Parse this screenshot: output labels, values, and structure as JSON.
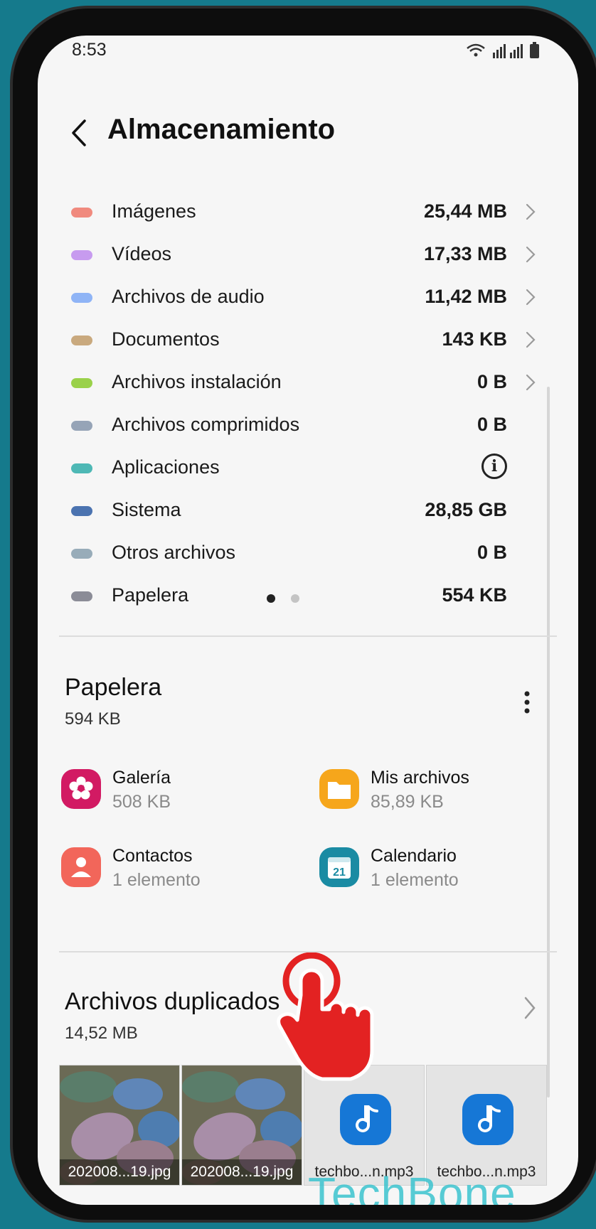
{
  "status": {
    "time": "8:53",
    "icons": "wifi-icon signal-icon signal-icon battery-icon"
  },
  "header": {
    "title": "Almacenamiento"
  },
  "storage_items": [
    {
      "label": "Imágenes",
      "value": "25,44 MB",
      "color": "#f08a7e",
      "chevron": true
    },
    {
      "label": "Vídeos",
      "value": "17,33 MB",
      "color": "#c79bef",
      "chevron": true
    },
    {
      "label": "Archivos de audio",
      "value": "11,42 MB",
      "color": "#8fb4f6",
      "chevron": true
    },
    {
      "label": "Documentos",
      "value": "143 KB",
      "color": "#c9a97e",
      "chevron": true
    },
    {
      "label": "Archivos instalación",
      "value": "0 B",
      "color": "#9ad14a",
      "chevron": true
    },
    {
      "label": "Archivos comprimidos",
      "value": "0 B",
      "color": "#96a4b7",
      "chevron": false
    },
    {
      "label": "Aplicaciones",
      "value": "",
      "color": "#4eb8b5",
      "chevron": false,
      "info_icon": true
    },
    {
      "label": "Sistema",
      "value": "28,85 GB",
      "color": "#4b73b0",
      "chevron": false
    },
    {
      "label": "Otros archivos",
      "value": "0 B",
      "color": "#98acb9",
      "chevron": false
    },
    {
      "label": "Papelera",
      "value": "554 KB",
      "color": "#8b8c97",
      "chevron": false
    }
  ],
  "pager": {
    "pages": 2,
    "active": 1,
    "active_color": "#222222",
    "inactive_color": "#c4c4c4"
  },
  "trash": {
    "title": "Papelera",
    "size": "594 KB",
    "apps": [
      {
        "name": "Galería",
        "detail": "508 KB",
        "icon": "gallery-icon",
        "color": "#d21a63"
      },
      {
        "name": "Mis archivos",
        "detail": "85,89 KB",
        "icon": "folder-icon",
        "color": "#f6a61b"
      },
      {
        "name": "Contactos",
        "detail": "1 elemento",
        "icon": "contacts-icon",
        "color": "#f2665a"
      },
      {
        "name": "Calendario",
        "detail": "1 elemento",
        "icon": "calendar-icon",
        "color": "#1a8ba3",
        "calendar_day": "21"
      }
    ]
  },
  "duplicates": {
    "title": "Archivos duplicados",
    "size": "14,52 MB",
    "files": [
      {
        "name": "202008...19.jpg",
        "type": "image"
      },
      {
        "name": "202008...19.jpg",
        "type": "image"
      },
      {
        "name": "techbo...n.mp3",
        "type": "audio"
      },
      {
        "name": "techbo...n.mp3",
        "type": "audio"
      }
    ]
  },
  "watermark": "TechBone"
}
